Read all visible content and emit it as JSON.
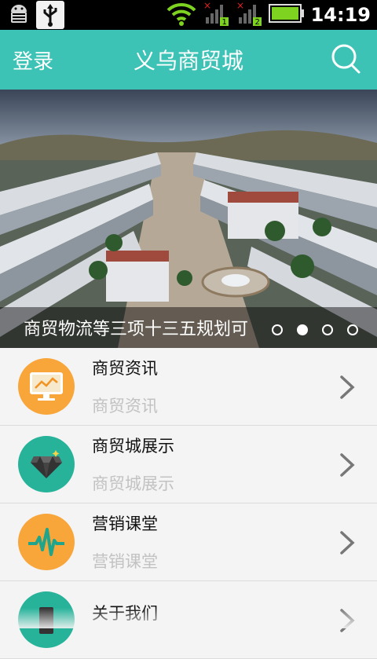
{
  "status_bar": {
    "time": "14:19",
    "icons": [
      "android-debug-icon",
      "usb-icon",
      "wifi-icon",
      "signal-1-icon",
      "signal-2-icon",
      "battery-icon"
    ]
  },
  "header": {
    "login_label": "登录",
    "title": "义乌商贸城",
    "search_icon": "search-icon",
    "background": "#3dc3b6"
  },
  "banner": {
    "caption": "商贸物流等三项十三五规划可",
    "slide_count": 4,
    "active_slide": 2
  },
  "menu": {
    "items": [
      {
        "title": "商贸资讯",
        "subtitle": "商贸资讯",
        "icon": "monitor-chart-icon",
        "color": "#f8a53a"
      },
      {
        "title": "商贸城展示",
        "subtitle": "商贸城展示",
        "icon": "diamond-icon",
        "color": "#26b39a"
      },
      {
        "title": "营销课堂",
        "subtitle": "营销课堂",
        "icon": "pulse-icon",
        "color": "#f8a53a"
      },
      {
        "title": "关于我们",
        "subtitle": "",
        "icon": "building-icon",
        "color": "#26b39a"
      }
    ]
  }
}
